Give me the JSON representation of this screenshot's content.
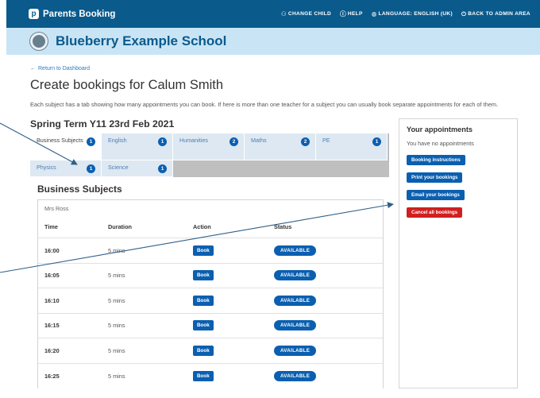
{
  "topbar": {
    "brand": "Parents Booking",
    "nav": [
      {
        "icon": "people-icon",
        "glyph": "⚇",
        "label": "CHANGE CHILD"
      },
      {
        "icon": "help-icon",
        "glyph": "ⓘ",
        "label": "HELP"
      },
      {
        "icon": "globe-icon",
        "glyph": "◍",
        "label": "LANGUAGE: ENGLISH (UK)"
      },
      {
        "icon": "power-icon",
        "glyph": "⏻",
        "label": "BACK TO ADMIN AREA"
      }
    ]
  },
  "school": {
    "name": "Blueberry Example School"
  },
  "back_link": "Return to Dashboard",
  "page_title": "Create bookings for Calum Smith",
  "intro": "Each subject has a tab showing how many appointments you can book. If here is more than one teacher for a subject you can usually book separate appointments for each of them.",
  "term_title": "Spring Term Y11 23rd Feb 2021",
  "tabs_row1": [
    {
      "label": "Business Subjects",
      "count": "1",
      "active": true
    },
    {
      "label": "English",
      "count": "1"
    },
    {
      "label": "Humanities",
      "count": "2"
    },
    {
      "label": "Maths",
      "count": "2"
    },
    {
      "label": "PE",
      "count": "1"
    }
  ],
  "tabs_row2": [
    {
      "label": "Physics",
      "count": "1"
    },
    {
      "label": "Science",
      "count": "1"
    }
  ],
  "subject_title": "Business Subjects",
  "teacher": "Mrs Ross",
  "table": {
    "headers": {
      "time": "Time",
      "duration": "Duration",
      "action": "Action",
      "status": "Status"
    },
    "rows": [
      {
        "time": "16:00",
        "duration": "5 mins",
        "action": "Book",
        "status": "AVAILABLE"
      },
      {
        "time": "16:05",
        "duration": "5 mins",
        "action": "Book",
        "status": "AVAILABLE"
      },
      {
        "time": "16:10",
        "duration": "5 mins",
        "action": "Book",
        "status": "AVAILABLE"
      },
      {
        "time": "16:15",
        "duration": "5 mins",
        "action": "Book",
        "status": "AVAILABLE"
      },
      {
        "time": "16:20",
        "duration": "5 mins",
        "action": "Book",
        "status": "AVAILABLE"
      },
      {
        "time": "16:25",
        "duration": "5 mins",
        "action": "Book",
        "status": "AVAILABLE"
      }
    ]
  },
  "appointments": {
    "title": "Your appointments",
    "empty": "You have no appointments",
    "buttons": {
      "instructions": "Booking instructions",
      "print": "Print your bookings",
      "email": "Email your bookings",
      "cancel": "Cancel all bookings"
    }
  },
  "colors": {
    "topbar": "#0a5a8c",
    "header": "#c9e5f5",
    "primary": "#0a5fb0",
    "danger": "#d01f1f",
    "annotation": "#2f5f8a"
  }
}
